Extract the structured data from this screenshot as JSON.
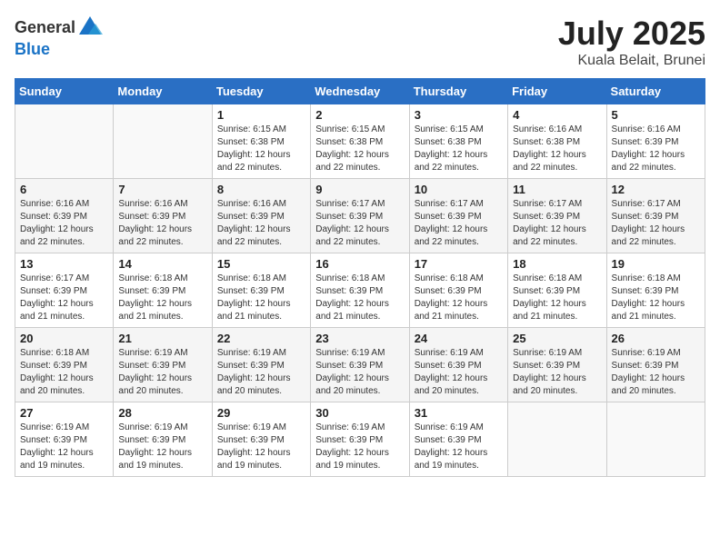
{
  "header": {
    "logo_general": "General",
    "logo_blue": "Blue",
    "month": "July 2025",
    "location": "Kuala Belait, Brunei"
  },
  "weekdays": [
    "Sunday",
    "Monday",
    "Tuesday",
    "Wednesday",
    "Thursday",
    "Friday",
    "Saturday"
  ],
  "weeks": [
    [
      {
        "day": "",
        "info": ""
      },
      {
        "day": "",
        "info": ""
      },
      {
        "day": "1",
        "info": "Sunrise: 6:15 AM\nSunset: 6:38 PM\nDaylight: 12 hours and 22 minutes."
      },
      {
        "day": "2",
        "info": "Sunrise: 6:15 AM\nSunset: 6:38 PM\nDaylight: 12 hours and 22 minutes."
      },
      {
        "day": "3",
        "info": "Sunrise: 6:15 AM\nSunset: 6:38 PM\nDaylight: 12 hours and 22 minutes."
      },
      {
        "day": "4",
        "info": "Sunrise: 6:16 AM\nSunset: 6:38 PM\nDaylight: 12 hours and 22 minutes."
      },
      {
        "day": "5",
        "info": "Sunrise: 6:16 AM\nSunset: 6:39 PM\nDaylight: 12 hours and 22 minutes."
      }
    ],
    [
      {
        "day": "6",
        "info": "Sunrise: 6:16 AM\nSunset: 6:39 PM\nDaylight: 12 hours and 22 minutes."
      },
      {
        "day": "7",
        "info": "Sunrise: 6:16 AM\nSunset: 6:39 PM\nDaylight: 12 hours and 22 minutes."
      },
      {
        "day": "8",
        "info": "Sunrise: 6:16 AM\nSunset: 6:39 PM\nDaylight: 12 hours and 22 minutes."
      },
      {
        "day": "9",
        "info": "Sunrise: 6:17 AM\nSunset: 6:39 PM\nDaylight: 12 hours and 22 minutes."
      },
      {
        "day": "10",
        "info": "Sunrise: 6:17 AM\nSunset: 6:39 PM\nDaylight: 12 hours and 22 minutes."
      },
      {
        "day": "11",
        "info": "Sunrise: 6:17 AM\nSunset: 6:39 PM\nDaylight: 12 hours and 22 minutes."
      },
      {
        "day": "12",
        "info": "Sunrise: 6:17 AM\nSunset: 6:39 PM\nDaylight: 12 hours and 22 minutes."
      }
    ],
    [
      {
        "day": "13",
        "info": "Sunrise: 6:17 AM\nSunset: 6:39 PM\nDaylight: 12 hours and 21 minutes."
      },
      {
        "day": "14",
        "info": "Sunrise: 6:18 AM\nSunset: 6:39 PM\nDaylight: 12 hours and 21 minutes."
      },
      {
        "day": "15",
        "info": "Sunrise: 6:18 AM\nSunset: 6:39 PM\nDaylight: 12 hours and 21 minutes."
      },
      {
        "day": "16",
        "info": "Sunrise: 6:18 AM\nSunset: 6:39 PM\nDaylight: 12 hours and 21 minutes."
      },
      {
        "day": "17",
        "info": "Sunrise: 6:18 AM\nSunset: 6:39 PM\nDaylight: 12 hours and 21 minutes."
      },
      {
        "day": "18",
        "info": "Sunrise: 6:18 AM\nSunset: 6:39 PM\nDaylight: 12 hours and 21 minutes."
      },
      {
        "day": "19",
        "info": "Sunrise: 6:18 AM\nSunset: 6:39 PM\nDaylight: 12 hours and 21 minutes."
      }
    ],
    [
      {
        "day": "20",
        "info": "Sunrise: 6:18 AM\nSunset: 6:39 PM\nDaylight: 12 hours and 20 minutes."
      },
      {
        "day": "21",
        "info": "Sunrise: 6:19 AM\nSunset: 6:39 PM\nDaylight: 12 hours and 20 minutes."
      },
      {
        "day": "22",
        "info": "Sunrise: 6:19 AM\nSunset: 6:39 PM\nDaylight: 12 hours and 20 minutes."
      },
      {
        "day": "23",
        "info": "Sunrise: 6:19 AM\nSunset: 6:39 PM\nDaylight: 12 hours and 20 minutes."
      },
      {
        "day": "24",
        "info": "Sunrise: 6:19 AM\nSunset: 6:39 PM\nDaylight: 12 hours and 20 minutes."
      },
      {
        "day": "25",
        "info": "Sunrise: 6:19 AM\nSunset: 6:39 PM\nDaylight: 12 hours and 20 minutes."
      },
      {
        "day": "26",
        "info": "Sunrise: 6:19 AM\nSunset: 6:39 PM\nDaylight: 12 hours and 20 minutes."
      }
    ],
    [
      {
        "day": "27",
        "info": "Sunrise: 6:19 AM\nSunset: 6:39 PM\nDaylight: 12 hours and 19 minutes."
      },
      {
        "day": "28",
        "info": "Sunrise: 6:19 AM\nSunset: 6:39 PM\nDaylight: 12 hours and 19 minutes."
      },
      {
        "day": "29",
        "info": "Sunrise: 6:19 AM\nSunset: 6:39 PM\nDaylight: 12 hours and 19 minutes."
      },
      {
        "day": "30",
        "info": "Sunrise: 6:19 AM\nSunset: 6:39 PM\nDaylight: 12 hours and 19 minutes."
      },
      {
        "day": "31",
        "info": "Sunrise: 6:19 AM\nSunset: 6:39 PM\nDaylight: 12 hours and 19 minutes."
      },
      {
        "day": "",
        "info": ""
      },
      {
        "day": "",
        "info": ""
      }
    ]
  ]
}
